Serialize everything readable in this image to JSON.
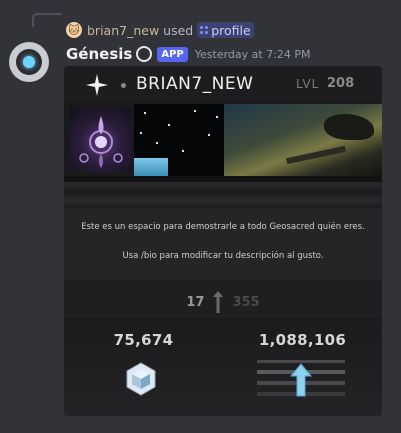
{
  "reply": {
    "username": "brian7_new",
    "used_text": "used",
    "command": "profile"
  },
  "message": {
    "bot_name": "Génesis",
    "app_tag": "APP",
    "timestamp": "Yesterday at 7:24 PM"
  },
  "profile": {
    "username": "BRIAN7_NEW",
    "level_label": "LVL",
    "level_value": "208",
    "bio_line1": "Este es un espacio para demostrarle a todo Geosacred quién eres.",
    "bio_line2": "Usa /bio para modificar tu descripción al gusto.",
    "rep_current": "17",
    "rep_next": "355",
    "stat_left": "75,674",
    "stat_right": "1,088,106"
  },
  "colors": {
    "background": "#313338",
    "app_tag": "#5865f2",
    "command_pill": "#3c4270",
    "card": "#1a1a1c"
  },
  "icons": {
    "reply_avatar": "cat-avatar-icon",
    "command": "slash-command-icon",
    "bot_avatar": "bot-orb-icon",
    "verified": "ring-badge-icon",
    "header_star": "four-point-star-icon",
    "rep": "up-arrow-icon",
    "left_stat": "hexagon-gem-icon",
    "right_stat": "rank-up-arrow-icon"
  }
}
